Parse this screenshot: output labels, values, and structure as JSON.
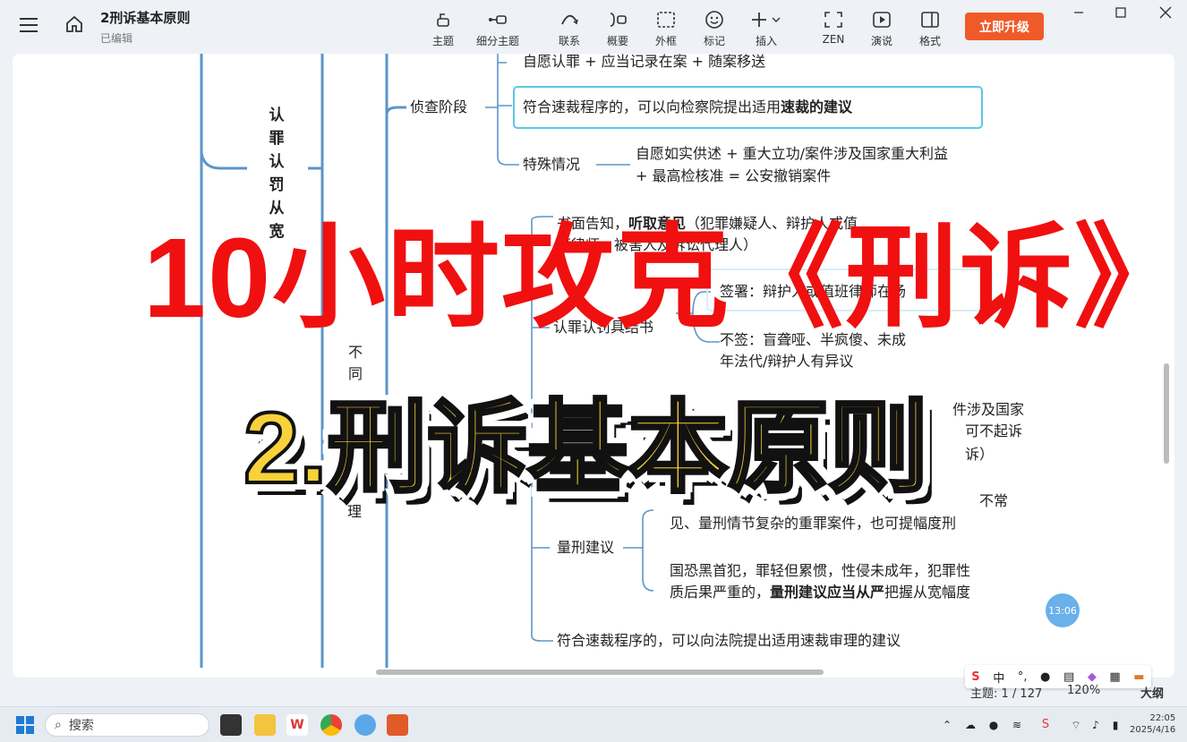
{
  "app": {
    "doc_title": "2刑诉基本原则",
    "doc_status": "已编辑",
    "upgrade_label": "立即升级"
  },
  "toolbar": {
    "items": [
      {
        "label": "主题",
        "icon": "topic-icon"
      },
      {
        "label": "细分主题",
        "icon": "subtopic-icon"
      },
      {
        "label": "联系",
        "icon": "relation-icon"
      },
      {
        "label": "概要",
        "icon": "summary-icon"
      },
      {
        "label": "外框",
        "icon": "boundary-icon"
      },
      {
        "label": "标记",
        "icon": "marker-icon"
      },
      {
        "label": "插入",
        "icon": "insert-icon"
      },
      {
        "label": "ZEN",
        "icon": "zen-icon"
      },
      {
        "label": "演说",
        "icon": "present-icon"
      },
      {
        "label": "格式",
        "icon": "format-icon"
      }
    ]
  },
  "mindmap": {
    "root_vertical": [
      "认",
      "罪",
      "认",
      "罚",
      "从",
      "宽"
    ],
    "branch_vertical": [
      "不",
      "同",
      "理"
    ],
    "stage": "侦查阶段",
    "node1": "自愿认罪 + 应当记录在案 + 随案移送",
    "node2_plain": "符合速裁程序的，可以向检察院提出适用",
    "node2_bold": "速裁的建议",
    "special_label": "特殊情况",
    "special_line1": "自愿如实供述 + 重大立功/案件涉及国家重大利益",
    "special_line2": "+ 最高检核准 = 公安撤销案件",
    "notice_a": "书面告知",
    "notice_bold": "听取意见",
    "notice_b": "（犯罪嫌疑人、辩护人或值",
    "notice_line2": "班律师、被害人及诉讼代理人）",
    "sign_label": "签署：辩护人或值班律师在场",
    "punish_label": "认罪认罚具结书",
    "no_sign_line1": "不签：盲聋哑、半疯傻、未成",
    "no_sign_line2": "年法代/辩护人有异议",
    "right_frag1": "件涉及国家",
    "right_frag2": "可不起诉",
    "right_frag3": "诉）",
    "sentence_frag1": "不常",
    "sentence_line2": "见、量刑情节复杂的重罪案件，也可提幅度刑",
    "sentence_label": "量刑建议",
    "strict_line1": "国恐黑首犯，罪轻但累惯，性侵未成年，犯罪性",
    "strict_a": "质后果严重的，",
    "strict_bold": "量刑建议应当从严",
    "strict_b": "把握从宽幅度",
    "fast_court": "符合速裁程序的，可以向法院提出适用速裁审理的建议"
  },
  "overlay": {
    "title_red": "10小时攻克《刑诉》",
    "title_yellow": "2.刑诉基本原则"
  },
  "timer": "13:06",
  "status": {
    "topic_count": "主题: 1 / 127",
    "zoom": "120%",
    "outline": "大纲"
  },
  "ime": [
    "中",
    "°,"
  ],
  "taskbar": {
    "search": "搜索",
    "time": "22:05",
    "date": "2025/4/16"
  }
}
